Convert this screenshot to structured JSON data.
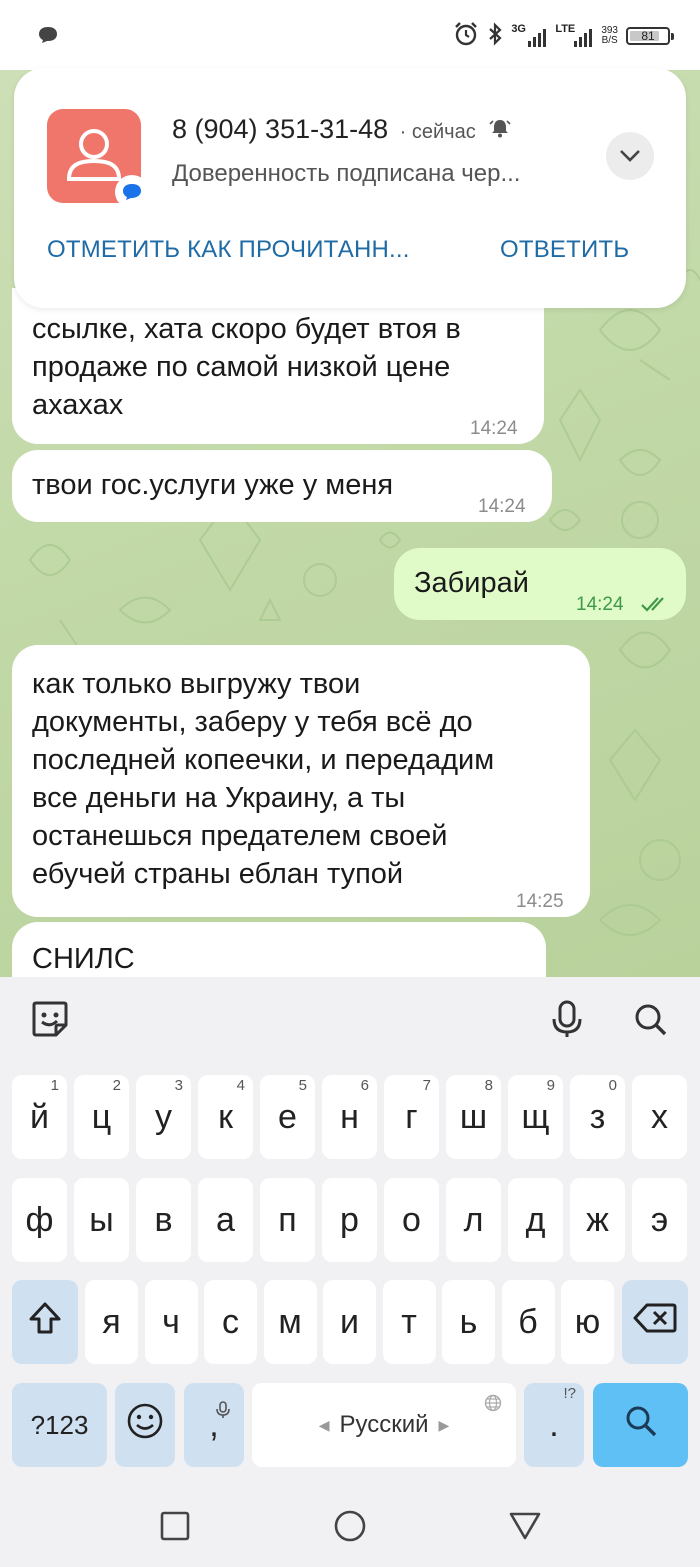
{
  "status_bar": {
    "network_3g": "3G",
    "network_lte": "LTE",
    "speed_value": "393",
    "speed_unit": "B/S",
    "battery": "81",
    "battery_level_percent": 81
  },
  "notification": {
    "sender": "8 (904) 351-31-48",
    "time": "· сейчас",
    "body": "Доверенность подписана чер...",
    "actions": {
      "mark_read": "ОТМЕТИТЬ КАК ПРОЧИТАНН...",
      "reply": "ОТВЕТИТЬ"
    }
  },
  "messages": [
    {
      "direction": "incoming",
      "lines": [
        "ссылке, хата скоро будет втоя в",
        "продаже по самой низкой цене",
        "ахахах"
      ],
      "time": "14:24"
    },
    {
      "direction": "incoming",
      "lines": [
        "твои гос.услуги уже у меня"
      ],
      "time": "14:24"
    },
    {
      "direction": "outgoing",
      "lines": [
        "Забирай"
      ],
      "time": "14:24",
      "status": "read"
    },
    {
      "direction": "incoming",
      "lines": [
        "как только выгружу твои",
        "документы, заберу у тебя всё до",
        "последней копеечки, и передадим",
        "все деньги на Украину, а ты",
        "останешься предателем своей",
        "ебучей страны еблан тупой"
      ],
      "time": "14:25"
    },
    {
      "direction": "incoming",
      "lines": [
        "СНИЛС"
      ],
      "time": ""
    }
  ],
  "keyboard": {
    "row1": [
      {
        "label": "й",
        "hint": "1"
      },
      {
        "label": "ц",
        "hint": "2"
      },
      {
        "label": "у",
        "hint": "3"
      },
      {
        "label": "к",
        "hint": "4"
      },
      {
        "label": "е",
        "hint": "5"
      },
      {
        "label": "н",
        "hint": "6"
      },
      {
        "label": "г",
        "hint": "7"
      },
      {
        "label": "ш",
        "hint": "8"
      },
      {
        "label": "щ",
        "hint": "9"
      },
      {
        "label": "з",
        "hint": "0"
      },
      {
        "label": "х",
        "hint": ""
      }
    ],
    "row2": [
      "ф",
      "ы",
      "в",
      "а",
      "п",
      "р",
      "о",
      "л",
      "д",
      "ж",
      "э"
    ],
    "row3": [
      "я",
      "ч",
      "с",
      "м",
      "и",
      "т",
      "ь",
      "б",
      "ю"
    ],
    "symbols_label": "?123",
    "comma_label": ",",
    "space_label": "Русский",
    "period_label": ".",
    "period_hint": "!?"
  },
  "colors": {
    "notification_action": "#1f6ba6",
    "avatar": "#f0766b",
    "outgoing_bubble": "#e1fbc8",
    "outgoing_time": "#3c9a48",
    "search_key": "#5fc0f5",
    "special_key": "#cfe0f0"
  },
  "icons": [
    "chat-bubble-icon",
    "alarm-icon",
    "bluetooth-icon",
    "signal-icon",
    "battery-icon",
    "person-icon",
    "messages-badge-icon",
    "bell-icon",
    "chevron-down-icon",
    "double-check-icon",
    "emoji-sticker-icon",
    "microphone-icon",
    "search-icon",
    "shift-icon",
    "backspace-icon",
    "smiley-icon",
    "globe-icon",
    "square-nav-icon",
    "circle-nav-icon",
    "triangle-nav-icon"
  ]
}
